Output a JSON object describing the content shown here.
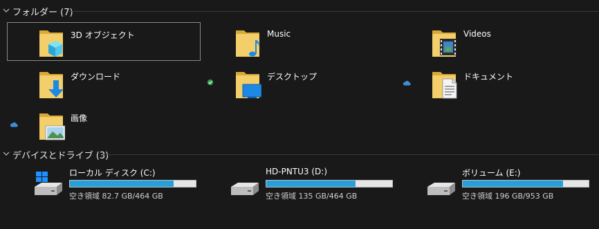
{
  "groups": {
    "folders": {
      "title": "フォルダー (7)"
    },
    "devices": {
      "title": "デバイスとドライブ (3)"
    }
  },
  "folders": [
    {
      "name": "3D オブジェクト",
      "icon": "3d-objects-icon",
      "selected": true,
      "status": null
    },
    {
      "name": "Music",
      "icon": "music-icon",
      "selected": false,
      "status": null
    },
    {
      "name": "Videos",
      "icon": "videos-icon",
      "selected": false,
      "status": null
    },
    {
      "name": "ダウンロード",
      "icon": "download-icon",
      "selected": false,
      "status": null
    },
    {
      "name": "デスクトップ",
      "icon": "desktop-icon",
      "selected": false,
      "status": "synced-check-icon"
    },
    {
      "name": "ドキュメント",
      "icon": "documents-icon",
      "selected": false,
      "status": "cloud-icon"
    },
    {
      "name": "画像",
      "icon": "pictures-icon",
      "selected": false,
      "status": "cloud-icon"
    }
  ],
  "drives": [
    {
      "name": "ローカル ディスク (C:)",
      "space": "空き領域 82.7 GB/464 GB",
      "used_fraction": 0.822,
      "icon": "windows-drive-icon"
    },
    {
      "name": "HD-PNTU3 (D:)",
      "space": "空き領域 135 GB/464 GB",
      "used_fraction": 0.709,
      "icon": "hard-drive-icon"
    },
    {
      "name": "ボリューム (E:)",
      "space": "空き領域 196 GB/953 GB",
      "used_fraction": 0.794,
      "icon": "hard-drive-icon"
    }
  ],
  "colors": {
    "background": "#191919",
    "folder_yellow": "#f3cf6b",
    "usage_bar": "#26a0da",
    "selection_border": "#8a8a8a"
  }
}
